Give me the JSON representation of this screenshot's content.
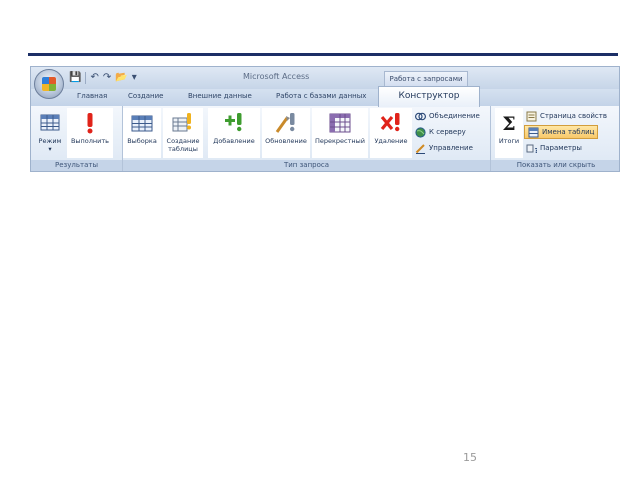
{
  "app": {
    "title": "Microsoft Access",
    "context_tab": "Работа с запросами"
  },
  "quick_access": [
    "💾",
    "↶",
    "↷",
    "📂",
    "▾"
  ],
  "tabs": [
    "Главная",
    "Создание",
    "Внешние данные",
    "Работа с базами данных"
  ],
  "active_tab": "Конструктор",
  "groups": {
    "results": {
      "label": "Результаты",
      "buttons": [
        {
          "label": "Режим",
          "icon": "table-view-icon"
        },
        {
          "label": "Выполнить",
          "icon": "run-exclamation-icon"
        }
      ]
    },
    "query_type": {
      "label": "Тип запроса",
      "buttons": [
        {
          "label": "Выборка",
          "icon": "select-query-icon"
        },
        {
          "label": "Создание таблицы",
          "icon": "make-table-icon"
        },
        {
          "label": "Добавление",
          "icon": "append-query-icon"
        },
        {
          "label": "Обновление",
          "icon": "update-query-icon"
        },
        {
          "label": "Перекрестный",
          "icon": "crosstab-query-icon"
        },
        {
          "label": "Удаление",
          "icon": "delete-query-icon"
        }
      ],
      "small_buttons": [
        {
          "label": "Объединение",
          "icon": "union-icon"
        },
        {
          "label": "К серверу",
          "icon": "globe-icon"
        },
        {
          "label": "Управление",
          "icon": "pencil-icon"
        }
      ]
    },
    "show_hide": {
      "label": "Показать или скрыть",
      "buttons": [
        {
          "label": "Итоги",
          "icon": "sigma-icon"
        }
      ],
      "small_buttons": [
        {
          "label": "Страница свойств",
          "icon": "property-sheet-icon"
        },
        {
          "label": "Имена таблиц",
          "icon": "table-names-icon"
        },
        {
          "label": "Параметры",
          "icon": "parameters-icon"
        }
      ]
    }
  },
  "page_number": "15"
}
